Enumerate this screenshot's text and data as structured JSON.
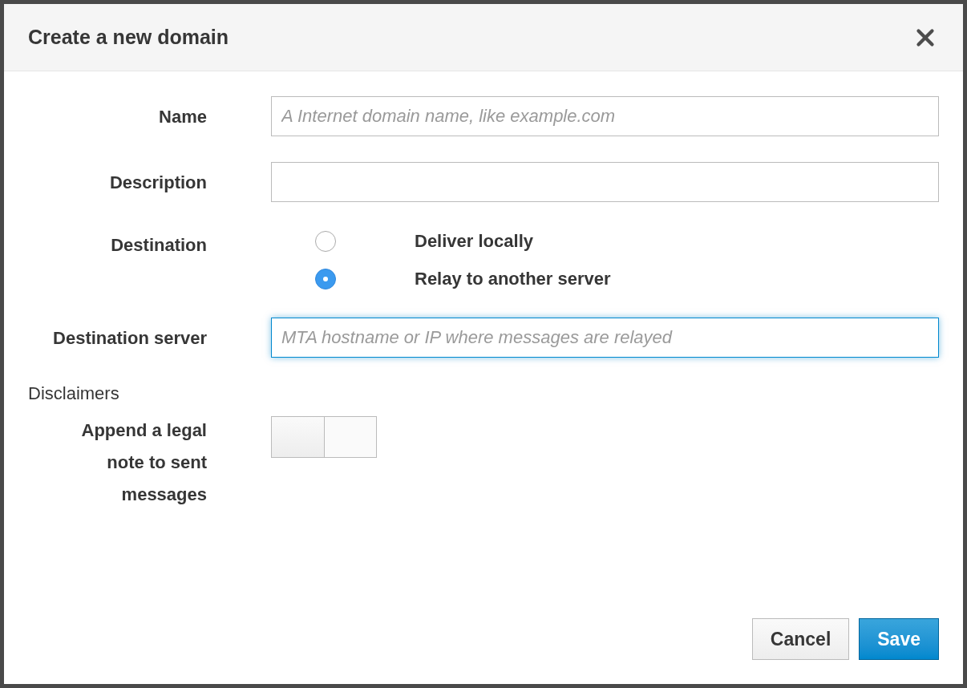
{
  "dialog": {
    "title": "Create a new domain"
  },
  "fields": [
    {
      "kind": "text",
      "label": "Name",
      "placeholder": "A Internet domain name, like example.com",
      "focused": false
    },
    {
      "kind": "text",
      "label": "Description",
      "focused": false
    },
    {
      "kind": "radio",
      "label": "Destination",
      "options": [
        {
          "label": "Deliver locally",
          "selected": false
        },
        {
          "label": "Relay to another server",
          "selected": true
        }
      ]
    },
    {
      "kind": "text",
      "label": "Destination server",
      "placeholder": "MTA hostname or IP where messages are relayed",
      "focused": true
    }
  ],
  "section": "Disclaimers",
  "toggle": {
    "label": "Append a legal note to sent messages",
    "on": false
  },
  "buttons": [
    {
      "label": "Cancel",
      "kind": "default"
    },
    {
      "label": "Save",
      "kind": "primary"
    }
  ]
}
